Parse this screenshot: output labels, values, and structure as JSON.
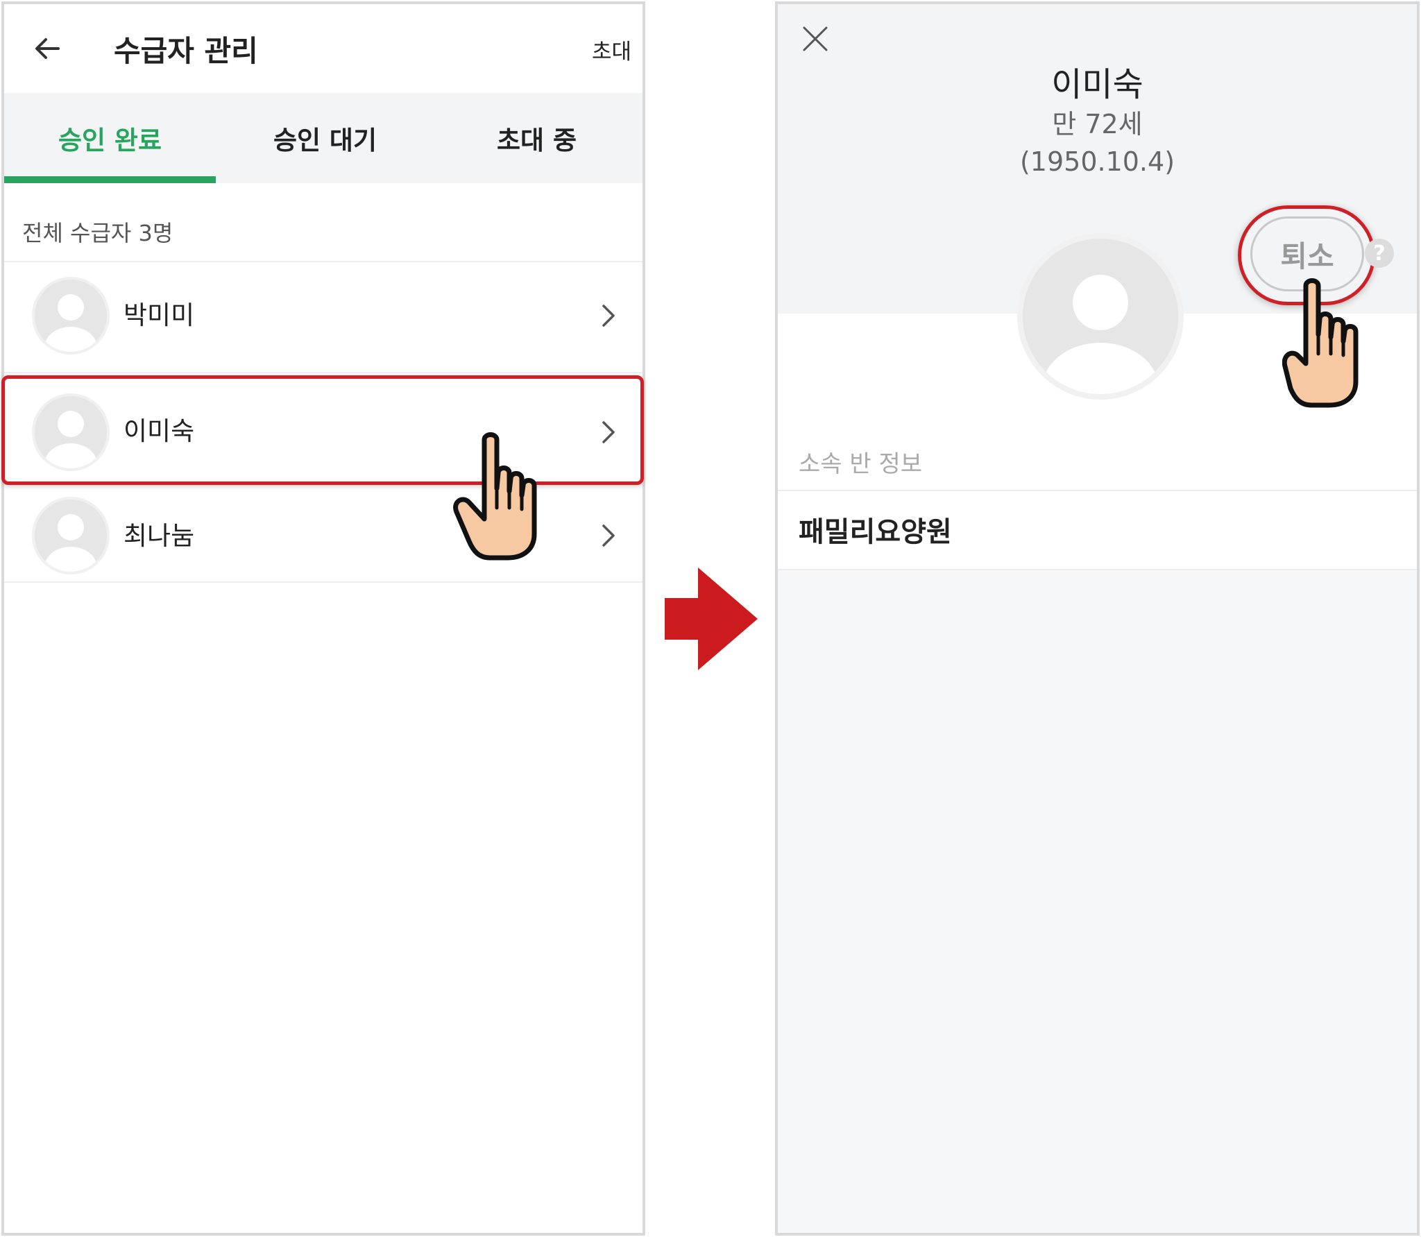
{
  "list_screen": {
    "title": "수급자 관리",
    "invite_label": "초대",
    "tabs": [
      {
        "label": "승인 완료"
      },
      {
        "label": "승인 대기"
      },
      {
        "label": "초대 중"
      }
    ],
    "count_label": "전체 수급자 3명",
    "recipients": [
      {
        "name": "박미미"
      },
      {
        "name": "이미숙"
      },
      {
        "name": "최나눔"
      }
    ]
  },
  "detail_screen": {
    "name": "이미숙",
    "age": "만 72세",
    "birth": "(1950.10.4)",
    "withdraw_label": "퇴소",
    "help_label": "?",
    "section_label": "소속 반 정보",
    "section_value": "패밀리요양원"
  },
  "colors": {
    "accent_green": "#27a45d",
    "highlight_red": "#cf2027",
    "arrow_red": "#cb1b1f"
  }
}
